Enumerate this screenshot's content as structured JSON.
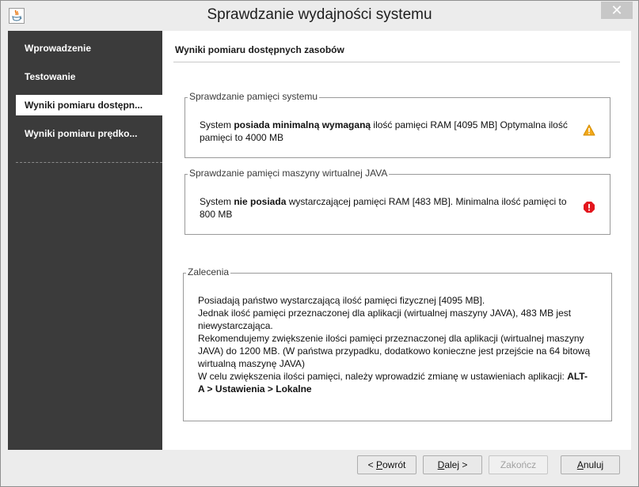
{
  "window": {
    "title": "Sprawdzanie wydajności systemu",
    "close_glyph": "✕",
    "app_icon": "java-icon"
  },
  "sidebar": {
    "items": [
      {
        "label": "Wprowadzenie",
        "active": false
      },
      {
        "label": "Testowanie",
        "active": false
      },
      {
        "label": "Wyniki pomiaru dostępn...",
        "active": true
      },
      {
        "label": "Wyniki pomiaru prędko...",
        "active": false
      }
    ]
  },
  "main": {
    "heading": "Wyniki pomiaru dostępnych zasobów",
    "system_memory": {
      "title": "Sprawdzanie pamięci systemu",
      "text_pre": "System ",
      "text_bold": "posiada minimalną wymaganą",
      "text_post": " ilość pamięci RAM [4095 MB] Optymalna ilość pamięci to 4000 MB",
      "status_icon": "warning-icon",
      "status_color": "#f2a91c"
    },
    "jvm_memory": {
      "title": "Sprawdzanie pamięci maszyny wirtualnej JAVA",
      "text_pre": "System ",
      "text_bold": "nie posiada",
      "text_post": " wystarczającej pamięci RAM [483 MB]. Minimalna ilość pamięci to 800 MB",
      "status_icon": "error-icon",
      "status_color": "#e3161d"
    },
    "recommendations": {
      "title": "Zalecenia",
      "line1": "Posiadają państwo wystarczającą ilość pamięci fizycznej [4095 MB].",
      "line2": "Jednak ilość pamięci przeznaczonej dla aplikacji (wirtualnej maszyny JAVA), 483 MB jest niewystarczająca.",
      "line3": "Rekomendujemy zwiększenie ilości pamięci przeznaczonej dla aplikacji (wirtualnej maszyny JAVA) do 1200 MB. (W państwa przypadku, dodatkowo konieczne jest przejście na 64 bitową wirtualną maszynę JAVA)",
      "line4_pre": "W celu zwiększenia ilości pamięci, należy wprowadzić zmianę w ustawieniach aplikacji: ",
      "line4_bold": "ALT-A > Ustawienia > Lokalne"
    }
  },
  "footer": {
    "back": {
      "prefix": "< ",
      "mnemonic": "P",
      "rest": "owrót"
    },
    "next": {
      "mnemonic": "D",
      "rest": "alej >"
    },
    "finish": {
      "label": "Zakończ"
    },
    "cancel": {
      "mnemonic": "A",
      "rest": "nuluj"
    }
  }
}
